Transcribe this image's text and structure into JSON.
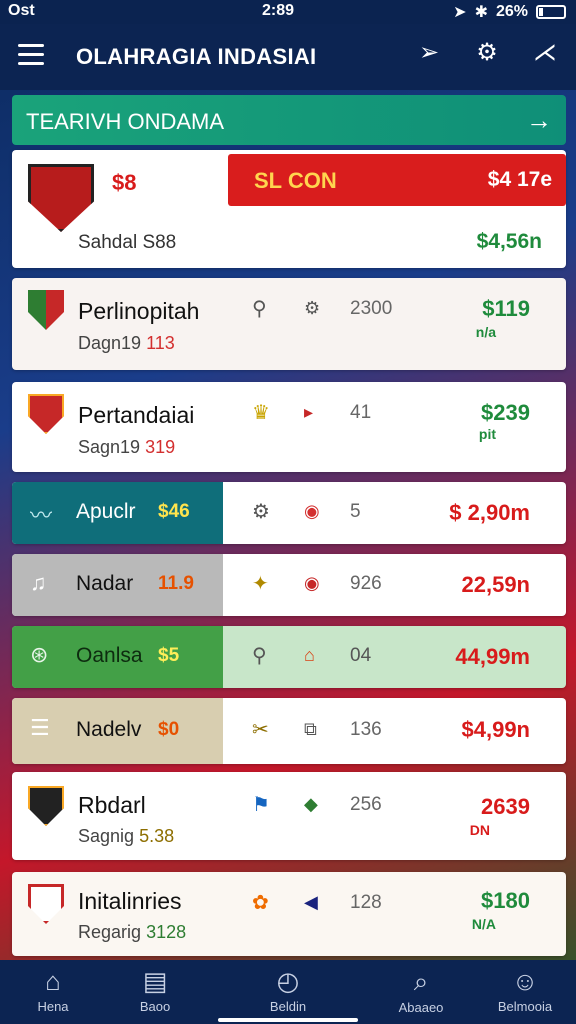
{
  "status": {
    "left": "Ost",
    "time": "2:89",
    "battery": "26%"
  },
  "appbar": {
    "title": "OLAHRAGIA INDASIAI"
  },
  "section": {
    "title": "TEARIVH ONDAMA",
    "arrow": "→"
  },
  "top_card": {
    "code": "$8",
    "banner_label": "SL CON",
    "banner_value": "$4 17e",
    "sub": "Sahdal S88",
    "amount": "$4,56n"
  },
  "rows": [
    {
      "name": "Perlinopitah",
      "sub": "Dagn19",
      "sub_accent": "113",
      "icon1": "⚲",
      "icon2": "⚙",
      "num": "2300",
      "amount": "$119",
      "unit": "n/a"
    },
    {
      "name": "Pertandaiai",
      "sub": "Sagn19",
      "sub_accent": "319",
      "icon1": "♛",
      "icon2": "▸",
      "num": "41",
      "amount": "$239",
      "unit": "pit"
    },
    {
      "name": "Apuclr",
      "band_val": "$46",
      "icon1": "⚙",
      "icon2": "◉",
      "num": "5",
      "amount": "$ 2,90m"
    },
    {
      "name": "Nadar",
      "band_val": "11.9",
      "icon1": "✦",
      "icon2": "◉",
      "num": "926",
      "amount": "22,59n"
    },
    {
      "name": "Oanlsa",
      "band_val": "$5",
      "icon1": "⚲",
      "icon2": "⌂",
      "num": "04",
      "amount": "44,99m"
    },
    {
      "name": "Nadelv",
      "band_val": "$0",
      "icon1": "✂",
      "icon2": "⧉",
      "num": "136",
      "amount": "$4,99n"
    },
    {
      "name": "Rbdarl",
      "sub": "Sagnig",
      "sub_accent": "5.38",
      "icon1": "⚑",
      "icon2": "◆",
      "num": "256",
      "amount": "2639",
      "unit": "DN"
    },
    {
      "name": "Initalinries",
      "sub": "Regarig",
      "sub_accent": "3128",
      "icon1": "✿",
      "icon2": "◀",
      "num": "128",
      "amount": "$180",
      "unit": "N/A"
    }
  ],
  "nav": [
    {
      "label": "Hena"
    },
    {
      "label": "Baoo"
    },
    {
      "label": "Beldin"
    },
    {
      "label": "Abaaeo"
    },
    {
      "label": "Belmooia"
    }
  ],
  "colors": {
    "appbar": "#0c2452",
    "section": "#1aa37a",
    "banner_red": "#d91d1d",
    "positive": "#1f8b3c",
    "negative": "#d81b1b"
  }
}
